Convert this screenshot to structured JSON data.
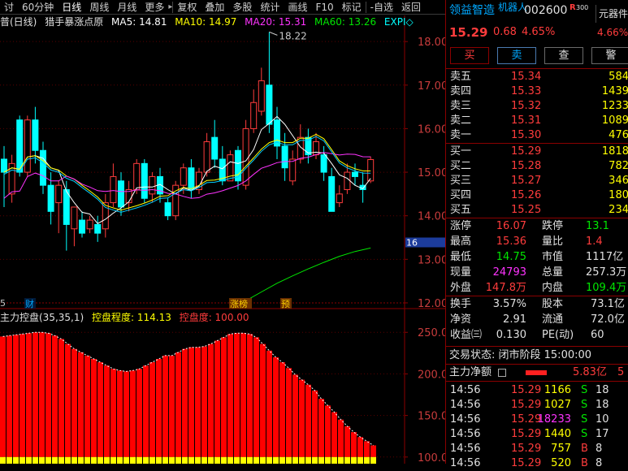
{
  "toolbar": {
    "items": [
      "讨",
      "60分钟",
      "日线",
      "周线",
      "月线",
      "更多",
      "复权",
      "叠加",
      "多股",
      "统计",
      "画线",
      "F10",
      "标记",
      "-自选",
      "返回"
    ],
    "more_arrow": "▸"
  },
  "indicator_header": {
    "name": "普(日线)",
    "formula": "猎手暴涨点原",
    "ma5": "MA5: 14.81",
    "ma10": "MA10: 14.97",
    "ma20": "MA20: 15.31",
    "ma60": "MA60: 13.26",
    "expma": "EXPI◇"
  },
  "main_chart": {
    "price_labels": [
      "18.00",
      "17.00",
      "16.00",
      "15.00",
      "14.00",
      "13.00",
      "12.00"
    ],
    "high_marker": "18.22",
    "current_price_tag": "16",
    "left_low_marker": "5",
    "event_tags": [
      "财",
      "涨榜",
      "预"
    ],
    "candles": [
      {
        "o": 15.3,
        "c": 15.0,
        "h": 15.6,
        "l": 14.2
      },
      {
        "o": 14.5,
        "c": 15.2,
        "h": 15.4,
        "l": 14.3
      },
      {
        "o": 16.2,
        "c": 15.0,
        "h": 16.3,
        "l": 14.9
      },
      {
        "o": 15.0,
        "c": 16.2,
        "h": 16.3,
        "l": 14.9
      },
      {
        "o": 16.2,
        "c": 15.5,
        "h": 16.5,
        "l": 15.2
      },
      {
        "o": 15.5,
        "c": 14.7,
        "h": 15.7,
        "l": 14.5
      },
      {
        "o": 14.7,
        "c": 14.1,
        "h": 15.0,
        "l": 13.8
      },
      {
        "o": 14.3,
        "c": 14.7,
        "h": 14.8,
        "l": 13.6
      },
      {
        "o": 14.6,
        "c": 13.8,
        "h": 14.8,
        "l": 13.2
      },
      {
        "o": 13.7,
        "c": 14.2,
        "h": 14.2,
        "l": 13.3
      },
      {
        "o": 13.9,
        "c": 13.6,
        "h": 14.1,
        "l": 13.5
      },
      {
        "o": 13.7,
        "c": 13.9,
        "h": 14.0,
        "l": 13.6
      },
      {
        "o": 13.8,
        "c": 13.6,
        "h": 14.0,
        "l": 13.4
      },
      {
        "o": 13.7,
        "c": 14.3,
        "h": 14.5,
        "l": 13.5
      },
      {
        "o": 14.3,
        "c": 14.9,
        "h": 15.2,
        "l": 14.2
      },
      {
        "o": 14.8,
        "c": 14.2,
        "h": 15.0,
        "l": 14.0
      },
      {
        "o": 14.3,
        "c": 14.6,
        "h": 14.8,
        "l": 14.1
      },
      {
        "o": 14.6,
        "c": 15.2,
        "h": 15.3,
        "l": 14.5
      },
      {
        "o": 15.2,
        "c": 14.4,
        "h": 15.3,
        "l": 14.3
      },
      {
        "o": 14.5,
        "c": 14.9,
        "h": 15.0,
        "l": 14.3
      },
      {
        "o": 14.9,
        "c": 14.5,
        "h": 15.1,
        "l": 14.3
      },
      {
        "o": 14.3,
        "c": 14.0,
        "h": 14.4,
        "l": 13.9
      },
      {
        "o": 14.0,
        "c": 14.7,
        "h": 14.8,
        "l": 13.9
      },
      {
        "o": 14.7,
        "c": 15.1,
        "h": 15.2,
        "l": 14.5
      },
      {
        "o": 15.1,
        "c": 14.6,
        "h": 15.3,
        "l": 14.4
      },
      {
        "o": 14.6,
        "c": 15.0,
        "h": 15.1,
        "l": 14.5
      },
      {
        "o": 15.0,
        "c": 15.7,
        "h": 15.9,
        "l": 14.9
      },
      {
        "o": 15.8,
        "c": 15.3,
        "h": 16.2,
        "l": 15.1
      },
      {
        "o": 15.3,
        "c": 14.8,
        "h": 15.6,
        "l": 14.7
      },
      {
        "o": 14.8,
        "c": 15.4,
        "h": 15.5,
        "l": 14.8
      },
      {
        "o": 15.5,
        "c": 14.8,
        "h": 15.6,
        "l": 14.6
      },
      {
        "o": 14.7,
        "c": 16.0,
        "h": 16.2,
        "l": 14.6
      },
      {
        "o": 16.0,
        "c": 16.6,
        "h": 16.9,
        "l": 15.9
      },
      {
        "o": 16.4,
        "c": 17.1,
        "h": 17.4,
        "l": 16.3
      },
      {
        "o": 17.0,
        "c": 16.1,
        "h": 18.22,
        "l": 15.9
      },
      {
        "o": 16.2,
        "c": 15.6,
        "h": 16.5,
        "l": 15.3
      },
      {
        "o": 15.6,
        "c": 15.1,
        "h": 15.9,
        "l": 14.8
      },
      {
        "o": 14.8,
        "c": 15.3,
        "h": 15.5,
        "l": 14.7
      },
      {
        "o": 15.3,
        "c": 15.8,
        "h": 16.1,
        "l": 15.2
      },
      {
        "o": 15.8,
        "c": 15.4,
        "h": 16.0,
        "l": 15.2
      },
      {
        "o": 15.4,
        "c": 15.7,
        "h": 15.9,
        "l": 15.3
      },
      {
        "o": 15.4,
        "c": 15.0,
        "h": 15.6,
        "l": 14.8
      },
      {
        "o": 14.9,
        "c": 14.1,
        "h": 15.1,
        "l": 14.1
      },
      {
        "o": 14.3,
        "c": 14.5,
        "h": 14.7,
        "l": 14.2
      },
      {
        "o": 14.6,
        "c": 15.0,
        "h": 15.2,
        "l": 14.5
      },
      {
        "o": 15.0,
        "c": 14.9,
        "h": 15.2,
        "l": 14.7
      },
      {
        "o": 14.7,
        "c": 14.6,
        "h": 15.0,
        "l": 14.3
      },
      {
        "o": 14.8,
        "c": 15.29,
        "h": 15.36,
        "l": 14.75
      }
    ],
    "ma60_line": [
      12.05,
      12.25,
      12.45,
      12.62,
      12.78,
      12.93,
      13.07,
      13.18,
      13.26
    ]
  },
  "sub_chart": {
    "title": "主力控盘(35,35,1)",
    "degree_label": "控盘程度: 114.13",
    "extent_label": "控盘度: 100.00",
    "axis_labels": [
      "250.0",
      "200.0",
      "150.0",
      "100.0"
    ],
    "values": [
      245,
      246,
      247,
      248,
      249,
      250,
      250,
      249,
      246,
      242,
      236,
      230,
      226,
      222,
      218,
      214,
      210,
      206,
      204,
      203,
      204,
      206,
      210,
      214,
      218,
      222,
      222,
      226,
      230,
      232,
      232,
      233,
      236,
      240,
      244,
      248,
      249,
      249,
      248,
      244,
      236,
      228,
      220,
      214,
      207,
      199,
      193,
      187,
      180,
      170,
      162,
      154,
      145,
      137,
      130,
      124,
      119,
      114
    ]
  },
  "quote": {
    "name": "领益智造",
    "sub_name": "机器人",
    "code": "002600",
    "r_badge": "R",
    "r_value": "300",
    "sector": "元器件",
    "price": "15.29",
    "change": "0.68",
    "percent": "4.65%",
    "sector_percent": "4.66%",
    "buttons": [
      "买",
      "卖",
      "查",
      "警"
    ],
    "asks": [
      {
        "label": "卖五",
        "price": "15.34",
        "vol": "584"
      },
      {
        "label": "卖四",
        "price": "15.33",
        "vol": "1439"
      },
      {
        "label": "卖三",
        "price": "15.32",
        "vol": "1233"
      },
      {
        "label": "卖二",
        "price": "15.31",
        "vol": "1089"
      },
      {
        "label": "卖一",
        "price": "15.30",
        "vol": "476"
      }
    ],
    "bids": [
      {
        "label": "买一",
        "price": "15.29",
        "vol": "1818"
      },
      {
        "label": "买二",
        "price": "15.28",
        "vol": "782"
      },
      {
        "label": "买三",
        "price": "15.27",
        "vol": "346"
      },
      {
        "label": "买四",
        "price": "15.26",
        "vol": "180"
      },
      {
        "label": "买五",
        "price": "15.25",
        "vol": "234"
      }
    ],
    "stats1": [
      {
        "l1": "涨停",
        "v1": "16.07",
        "l2": "跌停",
        "v2": "13.1"
      },
      {
        "l1": "最高",
        "v1": "15.36",
        "l2": "量比",
        "v2": "1.4"
      },
      {
        "l1": "最低",
        "v1": "14.75",
        "l2": "市值",
        "v2": "1117亿"
      },
      {
        "l1": "现量",
        "v1": "24793",
        "l2": "总量",
        "v2": "257.3万"
      },
      {
        "l1": "外盘",
        "v1": "147.8万",
        "l2": "内盘",
        "v2": "109.4万"
      }
    ],
    "stats2": [
      {
        "l1": "换手",
        "v1": "3.57%",
        "l2": "股本",
        "v2": "73.1亿"
      },
      {
        "l1": "净资",
        "v1": "2.91",
        "l2": "流通",
        "v2": "72.0亿"
      },
      {
        "l1": "收益㈢",
        "v1": "0.130",
        "l2": "PE(动)",
        "v2": "60"
      }
    ],
    "trade_status": "交易状态: 闭市阶段 15:00:00",
    "main_net_label": "主力净额",
    "main_net_value": "5.83亿",
    "main_net_tail": "5",
    "ticks": [
      {
        "t": "14:56",
        "p": "15.29",
        "v": "1166",
        "s": "S",
        "x": "18"
      },
      {
        "t": "14:56",
        "p": "15.29",
        "v": "1027",
        "s": "S",
        "x": "18"
      },
      {
        "t": "14:56",
        "p": "15.29",
        "v": "18233",
        "s": "S",
        "x": "10"
      },
      {
        "t": "14:56",
        "p": "15.29",
        "v": "1440",
        "s": "S",
        "x": "17"
      },
      {
        "t": "14:56",
        "p": "15.29",
        "v": "757",
        "s": "B",
        "x": "8"
      },
      {
        "t": "14:56",
        "p": "15.29",
        "v": "520",
        "s": "B",
        "x": "8"
      }
    ]
  },
  "colors": {
    "up": "#ff3c3c",
    "down": "#00ffff",
    "ma5": "#ffffff",
    "ma10": "#ffff00",
    "ma20": "#ff33ff",
    "ma60": "#00e600",
    "bar": "#ff0000",
    "bar_base": "#ffff00"
  }
}
